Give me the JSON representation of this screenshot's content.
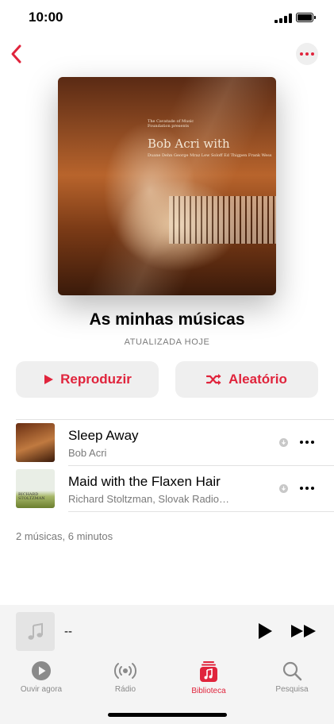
{
  "status": {
    "time": "10:00"
  },
  "playlist": {
    "title": "As minhas músicas",
    "updated": "ATUALIZADA HOJE",
    "artwork_text": {
      "presents": "The Cavatade of Music Foundation presents",
      "title": "Bob Acri with",
      "names": "Duane Dehn George Mraz Lew Soloff Ed Thigpen Frank Wess"
    }
  },
  "actions": {
    "play_label": "Reproduzir",
    "shuffle_label": "Aleatório"
  },
  "songs": [
    {
      "title": "Sleep Away",
      "artist": "Bob Acri"
    },
    {
      "title": "Maid with the Flaxen Hair",
      "artist": "Richard Stoltzman, Slovak Radio…",
      "thumb_text": "RICHARD STOLTZMAN"
    }
  ],
  "summary": "2 músicas, 6 minutos",
  "mini_player": {
    "title": "--"
  },
  "tabs": [
    {
      "label": "Ouvir agora",
      "icon": "play-circle-icon"
    },
    {
      "label": "Rádio",
      "icon": "radio-icon"
    },
    {
      "label": "Biblioteca",
      "icon": "library-icon",
      "active": true
    },
    {
      "label": "Pesquisa",
      "icon": "search-icon"
    }
  ],
  "colors": {
    "accent": "#e0243c",
    "secondary_text": "#7a7a7a",
    "button_bg": "#efefef"
  }
}
